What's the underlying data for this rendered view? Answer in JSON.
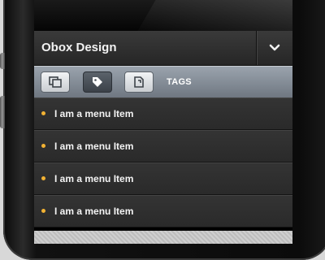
{
  "header": {
    "title": "Obox Design"
  },
  "tabs": {
    "label": "TAGS",
    "items": [
      {
        "icon": "pages-icon",
        "active": false
      },
      {
        "icon": "tag-icon",
        "active": true
      },
      {
        "icon": "document-icon",
        "active": false
      }
    ]
  },
  "menu": {
    "items": [
      {
        "label": "I am a menu Item"
      },
      {
        "label": "I am a menu Item"
      },
      {
        "label": "I am a menu Item"
      },
      {
        "label": "I am a menu Item"
      }
    ]
  },
  "colors": {
    "bullet": "#f2b233",
    "tab_bar": "#8a929b",
    "menu_bg": "#2f2f2f"
  }
}
